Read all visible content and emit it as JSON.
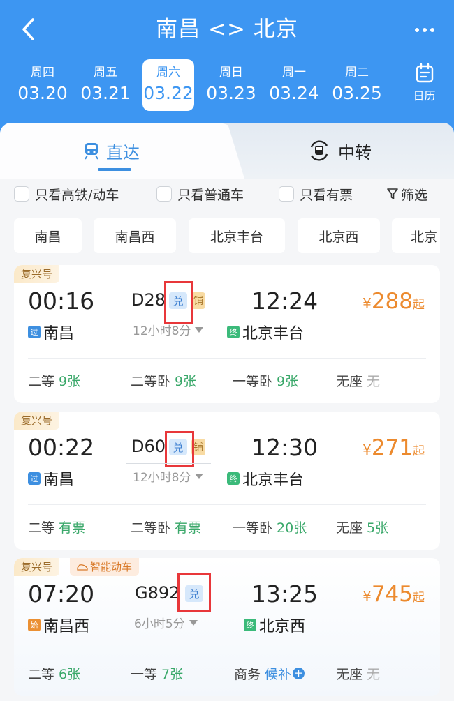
{
  "header": {
    "title": "南昌 <> 北京",
    "back_icon": "chevron-left-icon",
    "more_icon": "more-dots-icon"
  },
  "dates": [
    {
      "weekday": "周四",
      "date": "03.20",
      "active": false
    },
    {
      "weekday": "周五",
      "date": "03.21",
      "active": false
    },
    {
      "weekday": "周六",
      "date": "03.22",
      "active": true
    },
    {
      "weekday": "周日",
      "date": "03.23",
      "active": false
    },
    {
      "weekday": "周一",
      "date": "03.24",
      "active": false
    },
    {
      "weekday": "周二",
      "date": "03.25",
      "active": false
    }
  ],
  "calendar": {
    "label": "日历",
    "icon": "calendar-icon"
  },
  "tabs": [
    {
      "label": "直达",
      "icon": "train-icon",
      "active": true
    },
    {
      "label": "中转",
      "icon": "transfer-train-icon",
      "active": false
    }
  ],
  "filters": {
    "high_speed_only": {
      "label": "只看高铁/动车",
      "checked": false
    },
    "regular_only": {
      "label": "只看普通车",
      "checked": false
    },
    "available_only": {
      "label": "只看有票",
      "checked": false
    },
    "filter_button": {
      "label": "筛选",
      "icon": "filter-icon"
    }
  },
  "stations": [
    "南昌",
    "南昌西",
    "北京丰台",
    "北京西",
    "北京"
  ],
  "trains": [
    {
      "tags": [
        "复兴号"
      ],
      "dep_time": "00:16",
      "train_no": "D28",
      "badges": {
        "exchange": "兑",
        "sleeper": "铺"
      },
      "duration": "12小时8分",
      "arr_time": "12:24",
      "dep_station": {
        "badge": "过",
        "name": "南昌"
      },
      "arr_station": {
        "badge": "终",
        "name": "北京丰台"
      },
      "price": {
        "currency": "¥",
        "amount": "288",
        "suffix": "起"
      },
      "seats": [
        {
          "class": "二等",
          "avail": "9张",
          "status": "available"
        },
        {
          "class": "二等卧",
          "avail": "9张",
          "status": "available"
        },
        {
          "class": "一等卧",
          "avail": "9张",
          "status": "available"
        },
        {
          "class": "无座",
          "avail": "无",
          "status": "none"
        }
      ]
    },
    {
      "tags": [
        "复兴号"
      ],
      "dep_time": "00:22",
      "train_no": "D60",
      "badges": {
        "exchange": "兑",
        "sleeper": "铺"
      },
      "duration": "12小时8分",
      "arr_time": "12:30",
      "dep_station": {
        "badge": "过",
        "name": "南昌"
      },
      "arr_station": {
        "badge": "终",
        "name": "北京丰台"
      },
      "price": {
        "currency": "¥",
        "amount": "271",
        "suffix": "起"
      },
      "seats": [
        {
          "class": "二等",
          "avail": "有票",
          "status": "available"
        },
        {
          "class": "二等卧",
          "avail": "有票",
          "status": "available"
        },
        {
          "class": "一等卧",
          "avail": "20张",
          "status": "available"
        },
        {
          "class": "无座",
          "avail": "5张",
          "status": "available"
        }
      ]
    },
    {
      "tags": [
        "复兴号",
        "智能动车"
      ],
      "dep_time": "07:20",
      "train_no": "G892",
      "badges": {
        "exchange": "兑"
      },
      "duration": "6小时5分",
      "arr_time": "13:25",
      "dep_station": {
        "badge": "始",
        "name": "南昌西"
      },
      "arr_station": {
        "badge": "终",
        "name": "北京西"
      },
      "price": {
        "currency": "¥",
        "amount": "745",
        "suffix": "起"
      },
      "seats": [
        {
          "class": "二等",
          "avail": "6张",
          "status": "available"
        },
        {
          "class": "一等",
          "avail": "7张",
          "status": "available"
        },
        {
          "class": "商务",
          "avail": "候补",
          "status": "waitlist"
        },
        {
          "class": "无座",
          "avail": "无",
          "status": "none"
        }
      ]
    }
  ],
  "colors": {
    "brand_blue": "#3d96f2",
    "price_orange": "#ec8a2e",
    "available_green": "#3aa86a",
    "highlight_red": "#e8373a"
  }
}
